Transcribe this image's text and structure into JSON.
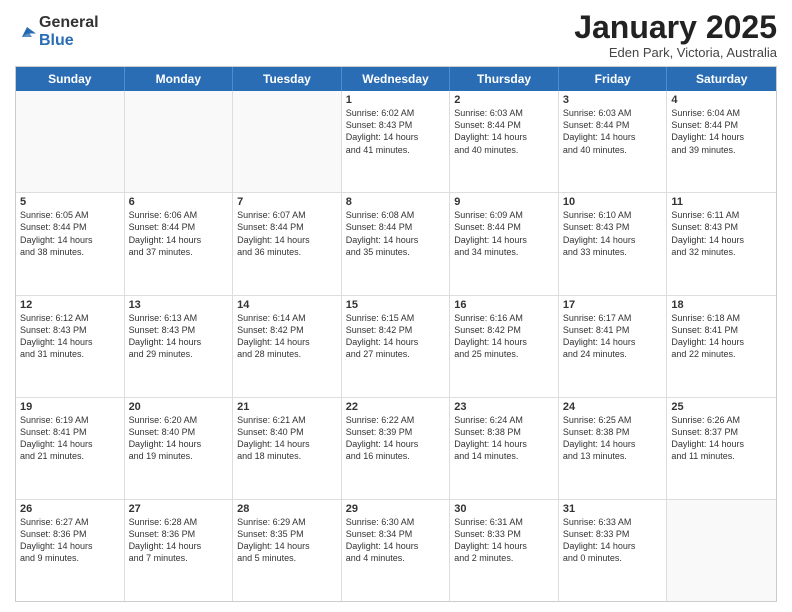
{
  "header": {
    "logo_general": "General",
    "logo_blue": "Blue",
    "title": "January 2025",
    "location": "Eden Park, Victoria, Australia"
  },
  "weekdays": [
    "Sunday",
    "Monday",
    "Tuesday",
    "Wednesday",
    "Thursday",
    "Friday",
    "Saturday"
  ],
  "rows": [
    [
      {
        "day": "",
        "text": "",
        "empty": true
      },
      {
        "day": "",
        "text": "",
        "empty": true
      },
      {
        "day": "",
        "text": "",
        "empty": true
      },
      {
        "day": "1",
        "text": "Sunrise: 6:02 AM\nSunset: 8:43 PM\nDaylight: 14 hours\nand 41 minutes.",
        "empty": false
      },
      {
        "day": "2",
        "text": "Sunrise: 6:03 AM\nSunset: 8:44 PM\nDaylight: 14 hours\nand 40 minutes.",
        "empty": false
      },
      {
        "day": "3",
        "text": "Sunrise: 6:03 AM\nSunset: 8:44 PM\nDaylight: 14 hours\nand 40 minutes.",
        "empty": false
      },
      {
        "day": "4",
        "text": "Sunrise: 6:04 AM\nSunset: 8:44 PM\nDaylight: 14 hours\nand 39 minutes.",
        "empty": false
      }
    ],
    [
      {
        "day": "5",
        "text": "Sunrise: 6:05 AM\nSunset: 8:44 PM\nDaylight: 14 hours\nand 38 minutes.",
        "empty": false
      },
      {
        "day": "6",
        "text": "Sunrise: 6:06 AM\nSunset: 8:44 PM\nDaylight: 14 hours\nand 37 minutes.",
        "empty": false
      },
      {
        "day": "7",
        "text": "Sunrise: 6:07 AM\nSunset: 8:44 PM\nDaylight: 14 hours\nand 36 minutes.",
        "empty": false
      },
      {
        "day": "8",
        "text": "Sunrise: 6:08 AM\nSunset: 8:44 PM\nDaylight: 14 hours\nand 35 minutes.",
        "empty": false
      },
      {
        "day": "9",
        "text": "Sunrise: 6:09 AM\nSunset: 8:44 PM\nDaylight: 14 hours\nand 34 minutes.",
        "empty": false
      },
      {
        "day": "10",
        "text": "Sunrise: 6:10 AM\nSunset: 8:43 PM\nDaylight: 14 hours\nand 33 minutes.",
        "empty": false
      },
      {
        "day": "11",
        "text": "Sunrise: 6:11 AM\nSunset: 8:43 PM\nDaylight: 14 hours\nand 32 minutes.",
        "empty": false
      }
    ],
    [
      {
        "day": "12",
        "text": "Sunrise: 6:12 AM\nSunset: 8:43 PM\nDaylight: 14 hours\nand 31 minutes.",
        "empty": false
      },
      {
        "day": "13",
        "text": "Sunrise: 6:13 AM\nSunset: 8:43 PM\nDaylight: 14 hours\nand 29 minutes.",
        "empty": false
      },
      {
        "day": "14",
        "text": "Sunrise: 6:14 AM\nSunset: 8:42 PM\nDaylight: 14 hours\nand 28 minutes.",
        "empty": false
      },
      {
        "day": "15",
        "text": "Sunrise: 6:15 AM\nSunset: 8:42 PM\nDaylight: 14 hours\nand 27 minutes.",
        "empty": false
      },
      {
        "day": "16",
        "text": "Sunrise: 6:16 AM\nSunset: 8:42 PM\nDaylight: 14 hours\nand 25 minutes.",
        "empty": false
      },
      {
        "day": "17",
        "text": "Sunrise: 6:17 AM\nSunset: 8:41 PM\nDaylight: 14 hours\nand 24 minutes.",
        "empty": false
      },
      {
        "day": "18",
        "text": "Sunrise: 6:18 AM\nSunset: 8:41 PM\nDaylight: 14 hours\nand 22 minutes.",
        "empty": false
      }
    ],
    [
      {
        "day": "19",
        "text": "Sunrise: 6:19 AM\nSunset: 8:41 PM\nDaylight: 14 hours\nand 21 minutes.",
        "empty": false
      },
      {
        "day": "20",
        "text": "Sunrise: 6:20 AM\nSunset: 8:40 PM\nDaylight: 14 hours\nand 19 minutes.",
        "empty": false
      },
      {
        "day": "21",
        "text": "Sunrise: 6:21 AM\nSunset: 8:40 PM\nDaylight: 14 hours\nand 18 minutes.",
        "empty": false
      },
      {
        "day": "22",
        "text": "Sunrise: 6:22 AM\nSunset: 8:39 PM\nDaylight: 14 hours\nand 16 minutes.",
        "empty": false
      },
      {
        "day": "23",
        "text": "Sunrise: 6:24 AM\nSunset: 8:38 PM\nDaylight: 14 hours\nand 14 minutes.",
        "empty": false
      },
      {
        "day": "24",
        "text": "Sunrise: 6:25 AM\nSunset: 8:38 PM\nDaylight: 14 hours\nand 13 minutes.",
        "empty": false
      },
      {
        "day": "25",
        "text": "Sunrise: 6:26 AM\nSunset: 8:37 PM\nDaylight: 14 hours\nand 11 minutes.",
        "empty": false
      }
    ],
    [
      {
        "day": "26",
        "text": "Sunrise: 6:27 AM\nSunset: 8:36 PM\nDaylight: 14 hours\nand 9 minutes.",
        "empty": false
      },
      {
        "day": "27",
        "text": "Sunrise: 6:28 AM\nSunset: 8:36 PM\nDaylight: 14 hours\nand 7 minutes.",
        "empty": false
      },
      {
        "day": "28",
        "text": "Sunrise: 6:29 AM\nSunset: 8:35 PM\nDaylight: 14 hours\nand 5 minutes.",
        "empty": false
      },
      {
        "day": "29",
        "text": "Sunrise: 6:30 AM\nSunset: 8:34 PM\nDaylight: 14 hours\nand 4 minutes.",
        "empty": false
      },
      {
        "day": "30",
        "text": "Sunrise: 6:31 AM\nSunset: 8:33 PM\nDaylight: 14 hours\nand 2 minutes.",
        "empty": false
      },
      {
        "day": "31",
        "text": "Sunrise: 6:33 AM\nSunset: 8:33 PM\nDaylight: 14 hours\nand 0 minutes.",
        "empty": false
      },
      {
        "day": "",
        "text": "",
        "empty": true
      }
    ]
  ]
}
